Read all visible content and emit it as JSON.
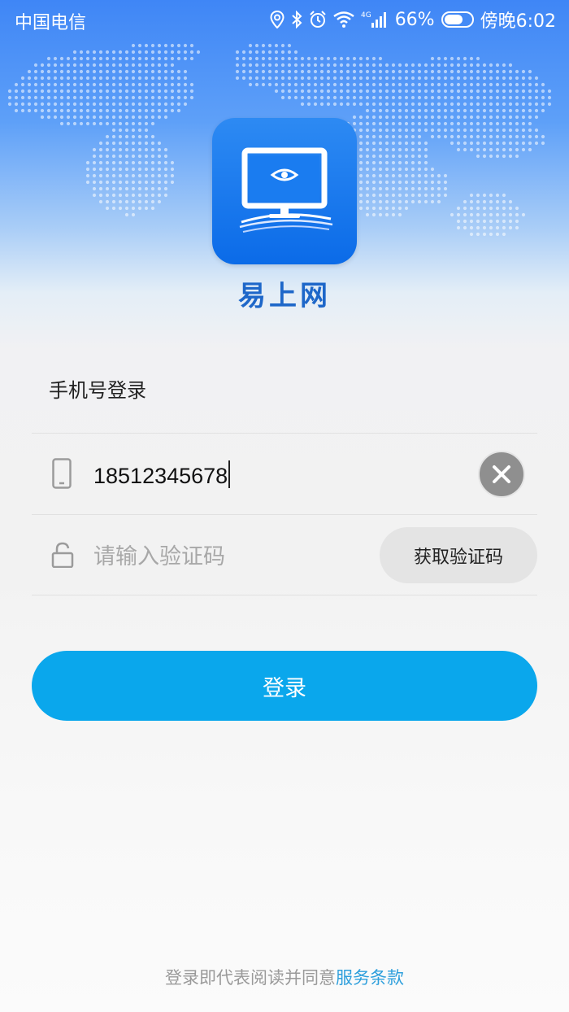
{
  "status_bar": {
    "carrier": "中国电信",
    "network_type": "4G",
    "battery_percent": "66%",
    "time": "傍晚6:02",
    "icons": [
      "location-icon",
      "bluetooth-icon",
      "alarm-icon",
      "wifi-icon",
      "signal-icon",
      "battery-icon"
    ]
  },
  "app": {
    "name": "易上网",
    "icon": "monitor-eye-icon",
    "brand_color": "#0b6be8"
  },
  "login_form": {
    "title": "手机号登录",
    "phone_value": "18512345678",
    "code_placeholder": "请输入验证码",
    "get_code_label": "获取验证码",
    "submit_label": "登录",
    "accent_color": "#0aa7ec"
  },
  "footer": {
    "agreement_prefix": "登录即代表阅读并同意",
    "terms_link": "服务条款"
  }
}
